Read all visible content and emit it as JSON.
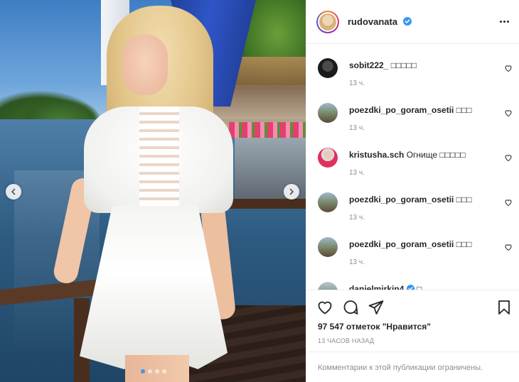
{
  "header": {
    "username": "rudovanata",
    "verified": true
  },
  "comments": [
    {
      "user": "sobit222_",
      "text": "□□□□□",
      "time": "13 ч.",
      "avatar": "dark"
    },
    {
      "user": "poezdki_po_goram_osetii",
      "text": "□□□",
      "time": "13 ч.",
      "avatar": "mountain"
    },
    {
      "user": "kristusha.sch",
      "text": "Огнище □□□□□",
      "time": "13 ч.",
      "avatar": "person"
    },
    {
      "user": "poezdki_po_goram_osetii",
      "text": "□□□",
      "time": "13 ч.",
      "avatar": "mountain"
    },
    {
      "user": "poezdki_po_goram_osetii",
      "text": "□□□",
      "time": "13 ч.",
      "avatar": "mountain"
    },
    {
      "user": "danielmirkin4",
      "text": "□",
      "time": "",
      "avatar": "mountain",
      "verified": true
    }
  ],
  "likes": {
    "count_text": "97 547 отметок \"Нравится\""
  },
  "timestamp": "13 ЧАСОВ НАЗАД",
  "restricted_text": "Комментарии к этой публикации ограничены.",
  "carousel": {
    "total_slides": 4,
    "active_slide": 1
  },
  "colors": {
    "verified": "#3897f0",
    "text": "#262626",
    "muted": "#8e8e8e",
    "border": "#efefef"
  },
  "icons": [
    "chevron-left-icon",
    "chevron-right-icon",
    "more-icon",
    "heart-icon",
    "comment-icon",
    "share-icon",
    "bookmark-icon",
    "verified-icon"
  ]
}
